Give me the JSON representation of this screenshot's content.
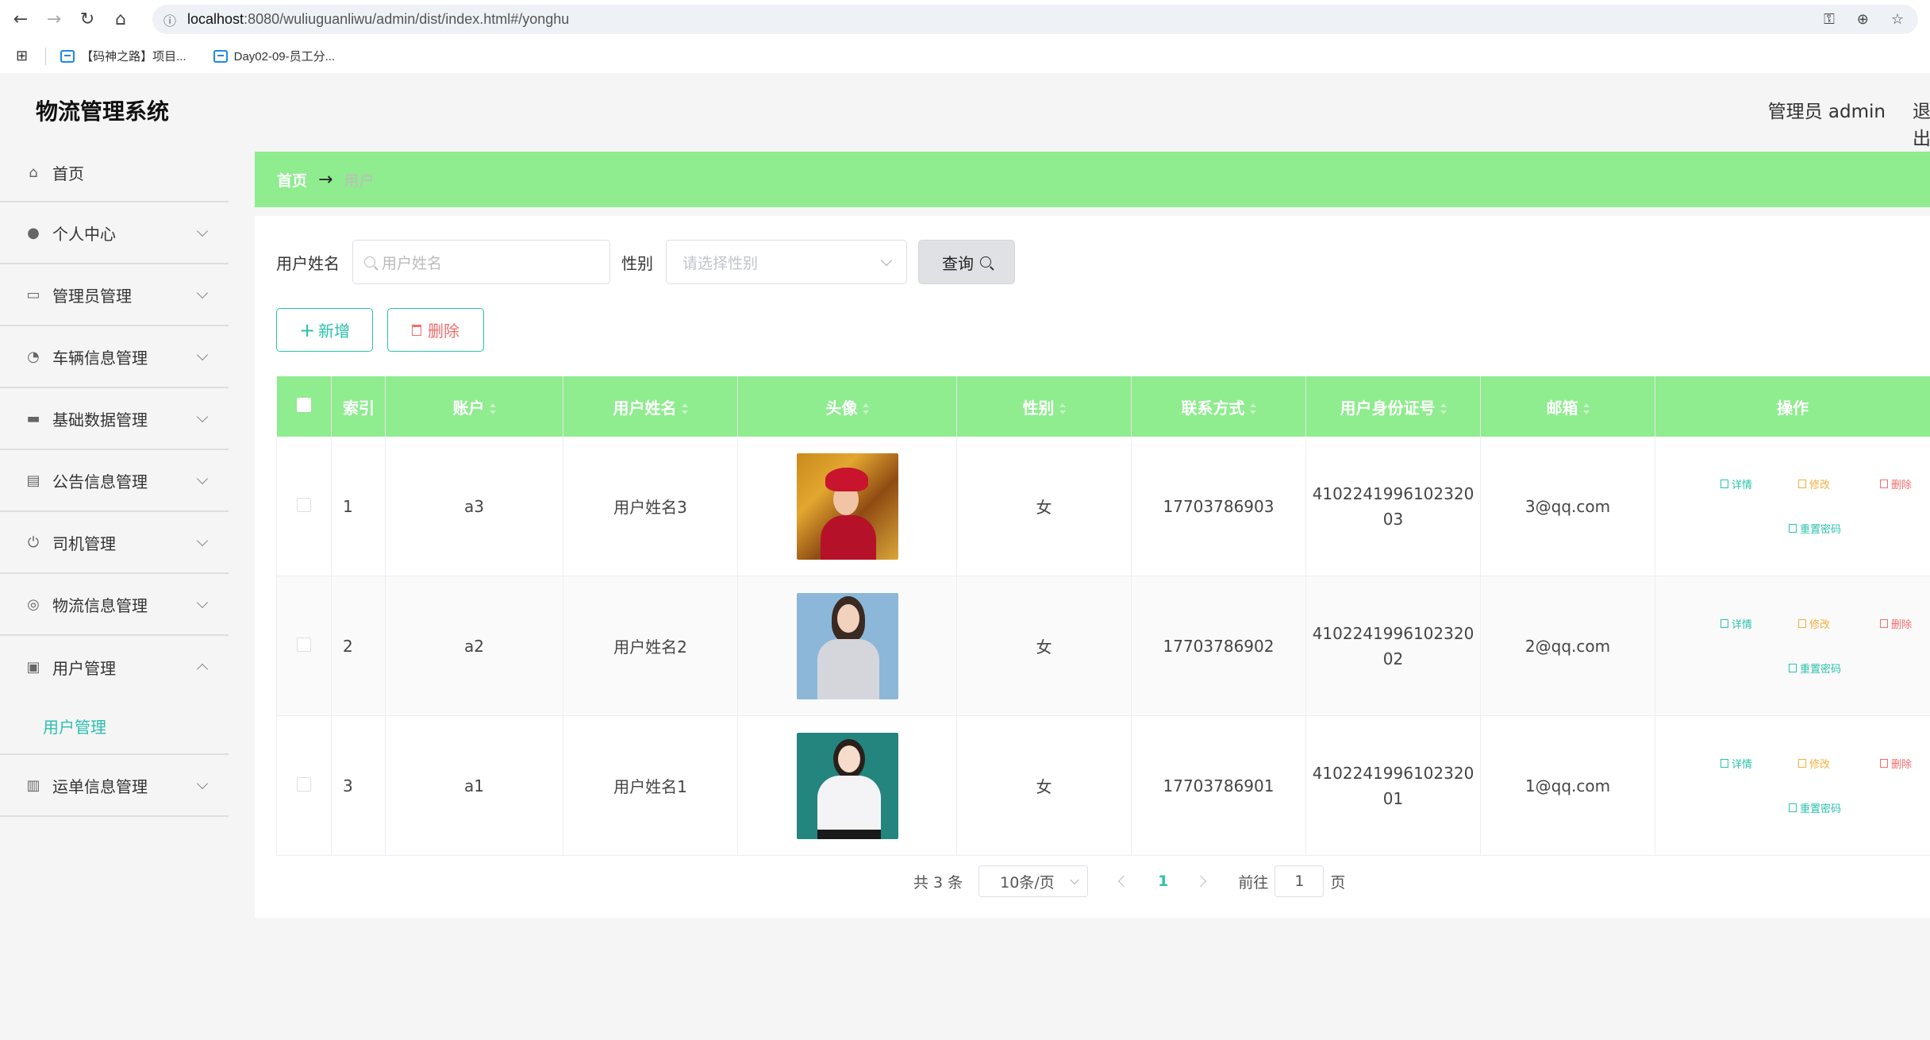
{
  "browser": {
    "url_host": "localhost",
    "url_rest": ":8080/wuliuguanliwu/admin/dist/index.html#/yonghu",
    "bookmarks": [
      "【码神之路】项目...",
      "Day02-09-员工分..."
    ]
  },
  "header": {
    "brand": "物流管理系统",
    "admin_label": "管理员 admin",
    "logout": "退出"
  },
  "sidebar": {
    "items": [
      {
        "label": "首页",
        "icon": "home-icon"
      },
      {
        "label": "个人中心",
        "icon": "user-icon"
      },
      {
        "label": "管理员管理",
        "icon": "chat-icon"
      },
      {
        "label": "车辆信息管理",
        "icon": "gauge-icon"
      },
      {
        "label": "基础数据管理",
        "icon": "message-icon"
      },
      {
        "label": "公告信息管理",
        "icon": "clipboard-icon"
      },
      {
        "label": "司机管理",
        "icon": "power-icon"
      },
      {
        "label": "物流信息管理",
        "icon": "globe-icon"
      },
      {
        "label": "用户管理",
        "icon": "checklist-icon"
      },
      {
        "label": "运单信息管理",
        "icon": "bar-chart-icon"
      }
    ],
    "submenu_label": "用户管理"
  },
  "breadcrumb": {
    "home": "首页",
    "current": "用户"
  },
  "search": {
    "name_label": "用户姓名",
    "name_placeholder": "用户姓名",
    "gender_label": "性别",
    "gender_placeholder": "请选择性别",
    "query_label": "查询"
  },
  "actions": {
    "add_label": "新增",
    "delete_label": "删除"
  },
  "table": {
    "columns": [
      "索引",
      "账户",
      "用户姓名",
      "头像",
      "性别",
      "联系方式",
      "用户身份证号",
      "邮箱",
      "操作"
    ],
    "rows": [
      {
        "index": "1",
        "account": "a3",
        "name": "用户姓名3",
        "gender": "女",
        "phone": "17703786903",
        "id_line1": "4102241996102320",
        "id_line2": "03",
        "email": "3@qq.com"
      },
      {
        "index": "2",
        "account": "a2",
        "name": "用户姓名2",
        "gender": "女",
        "phone": "17703786902",
        "id_line1": "4102241996102320",
        "id_line2": "02",
        "email": "2@qq.com"
      },
      {
        "index": "3",
        "account": "a1",
        "name": "用户姓名1",
        "gender": "女",
        "phone": "17703786901",
        "id_line1": "4102241996102320",
        "id_line2": "01",
        "email": "1@qq.com"
      }
    ],
    "op_labels": {
      "detail": "详情",
      "edit": "修改",
      "delete": "删除",
      "reset": "重置密码"
    }
  },
  "pager": {
    "total": "共 3 条",
    "page_size": "10条/页",
    "current": "1",
    "goto_prefix": "前往",
    "goto_value": "1",
    "goto_suffix": "页"
  },
  "colors": {
    "accent": "#2bc2ab",
    "header_green": "#8fec8f",
    "danger": "#f56c6c",
    "warning": "#f0b040"
  }
}
